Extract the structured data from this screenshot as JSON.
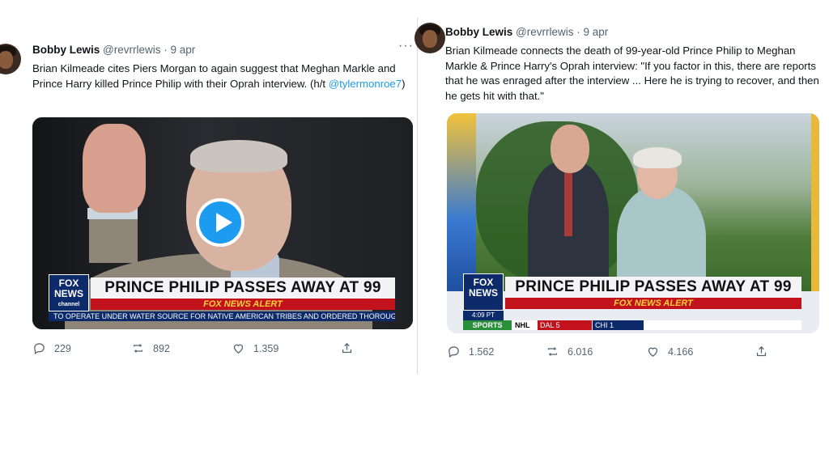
{
  "tweets": [
    {
      "author": {
        "name": "Bobby Lewis",
        "handle": "@revrrlewis",
        "separator": "·",
        "date": "9 apr"
      },
      "more_label": "···",
      "text": "Brian Kilmeade cites Piers Morgan to again suggest that Meghan Markle and Prince Harry killed Prince Philip with their Oprah interview. (h/t",
      "mention": "@tylermonroe7",
      "text_end": ")",
      "media": {
        "logo": "FOX",
        "logo_sub": "NEWS",
        "logo_tag": "channel",
        "headline": "PRINCE PHILIP PASSES AWAY AT 99",
        "alert": "FOX NEWS ALERT",
        "crawl": "TO OPERATE UNDER WATER SOURCE FOR NATIVE AMERICAN TRIBES AND ORDERED THOROUGH ENVIRON"
      },
      "stats": {
        "replies": "229",
        "retweets": "892",
        "likes": "1.359"
      }
    },
    {
      "author": {
        "name": "Bobby Lewis",
        "handle": "@revrrlewis",
        "separator": "·",
        "date": "9 apr"
      },
      "text": "Brian Kilmeade connects the death of 99-year-old Prince Philip to Meghan Markle & Prince Harry's Oprah interview: \"If you factor in this, there are reports that he was enraged after the interview ... Here he is trying to recover, and then he gets hit with that.\"",
      "media": {
        "logo": "FOX",
        "logo_sub": "NEWS",
        "time": "4:09 PT",
        "headline": "PRINCE PHILIP PASSES AWAY AT 99",
        "alert": "FOX NEWS ALERT",
        "sports": "SPORTS",
        "league": "NHL",
        "team1": "DAL   5",
        "team2": "CHI   1"
      },
      "stats": {
        "replies": "1.562",
        "retweets": "6.016",
        "likes": "4.166"
      }
    }
  ],
  "colors": {
    "link": "#1d9bf0",
    "fox_blue": "#0d2a6b",
    "alert_red": "#c2121b"
  }
}
